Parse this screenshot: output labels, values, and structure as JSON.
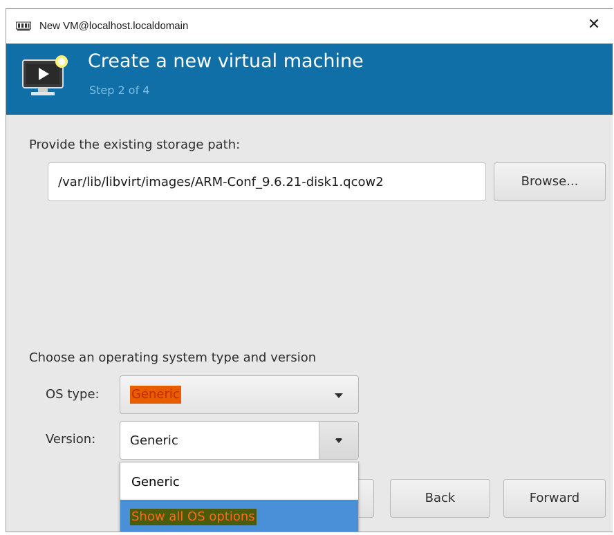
{
  "window": {
    "title": "New VM@localhost.localdomain",
    "app_icon": "virt-manager-icon",
    "close_glyph": "✕"
  },
  "header": {
    "heading": "Create a new virtual machine",
    "step": "Step 2 of 4",
    "icon": "new-vm-monitor-icon",
    "accent_color": "#0f6fa6"
  },
  "storage": {
    "label": "Provide the existing storage path:",
    "path_value": "/var/lib/libvirt/images/ARM-Conf_9.6.21-disk1.qcow2",
    "browse_label": "Browse..."
  },
  "os": {
    "section_label": "Choose an operating system type and version",
    "type_label": "OS type:",
    "type_value": "Generic",
    "version_label": "Version:",
    "version_value": "Generic",
    "dropdown_options": [
      {
        "label": "Generic",
        "selected": false
      },
      {
        "label": "Show all OS options",
        "selected": true
      }
    ]
  },
  "footer": {
    "back_label": "Back",
    "forward_label": "Forward"
  }
}
